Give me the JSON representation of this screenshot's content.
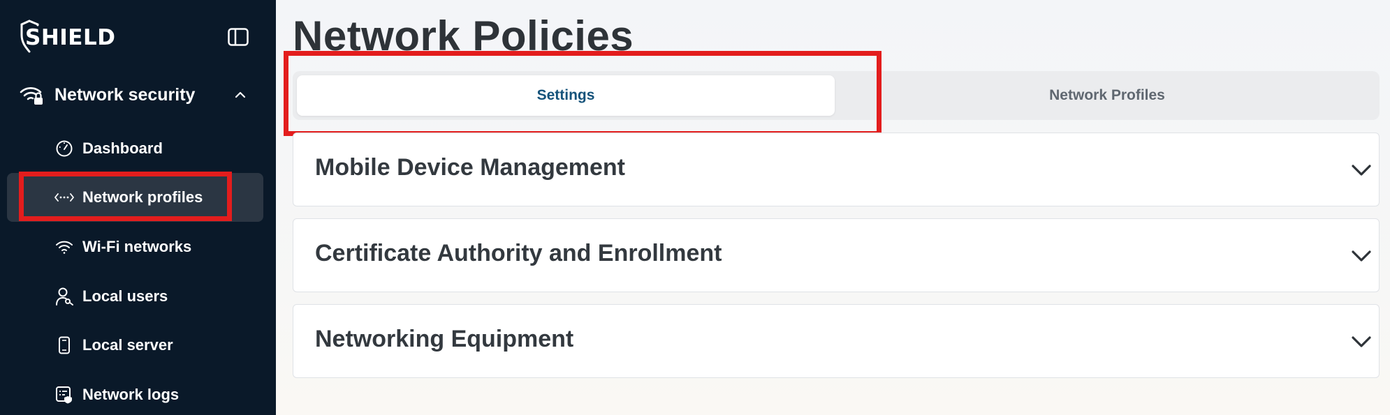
{
  "brand": {
    "name": "SHIELD"
  },
  "sidebar": {
    "section": {
      "label": "Network security",
      "icon": "wifi-lock-icon",
      "expanded": true
    },
    "items": [
      {
        "label": "Dashboard",
        "icon": "gauge-icon",
        "active": false
      },
      {
        "label": "Network profiles",
        "icon": "code-dots-icon",
        "active": true
      },
      {
        "label": "Wi-Fi networks",
        "icon": "wifi-icon",
        "active": false
      },
      {
        "label": "Local users",
        "icon": "user-key-icon",
        "active": false
      },
      {
        "label": "Local server",
        "icon": "phone-icon",
        "active": false
      },
      {
        "label": "Network logs",
        "icon": "log-icon",
        "active": false
      }
    ]
  },
  "main": {
    "title": "Network Policies",
    "tabs": [
      {
        "label": "Settings",
        "selected": true
      },
      {
        "label": "Network Profiles",
        "selected": false
      }
    ],
    "accordions": [
      {
        "title": "Mobile Device Management"
      },
      {
        "title": "Certificate Authority and Enrollment"
      },
      {
        "title": "Networking Equipment"
      }
    ]
  },
  "colors": {
    "sidebar_bg": "#0a1929",
    "active_item_bg": "#2b3643",
    "highlight": "#e31d1d",
    "tab_selected_text": "#14527a",
    "tab_unselected_text": "#5f6770"
  }
}
